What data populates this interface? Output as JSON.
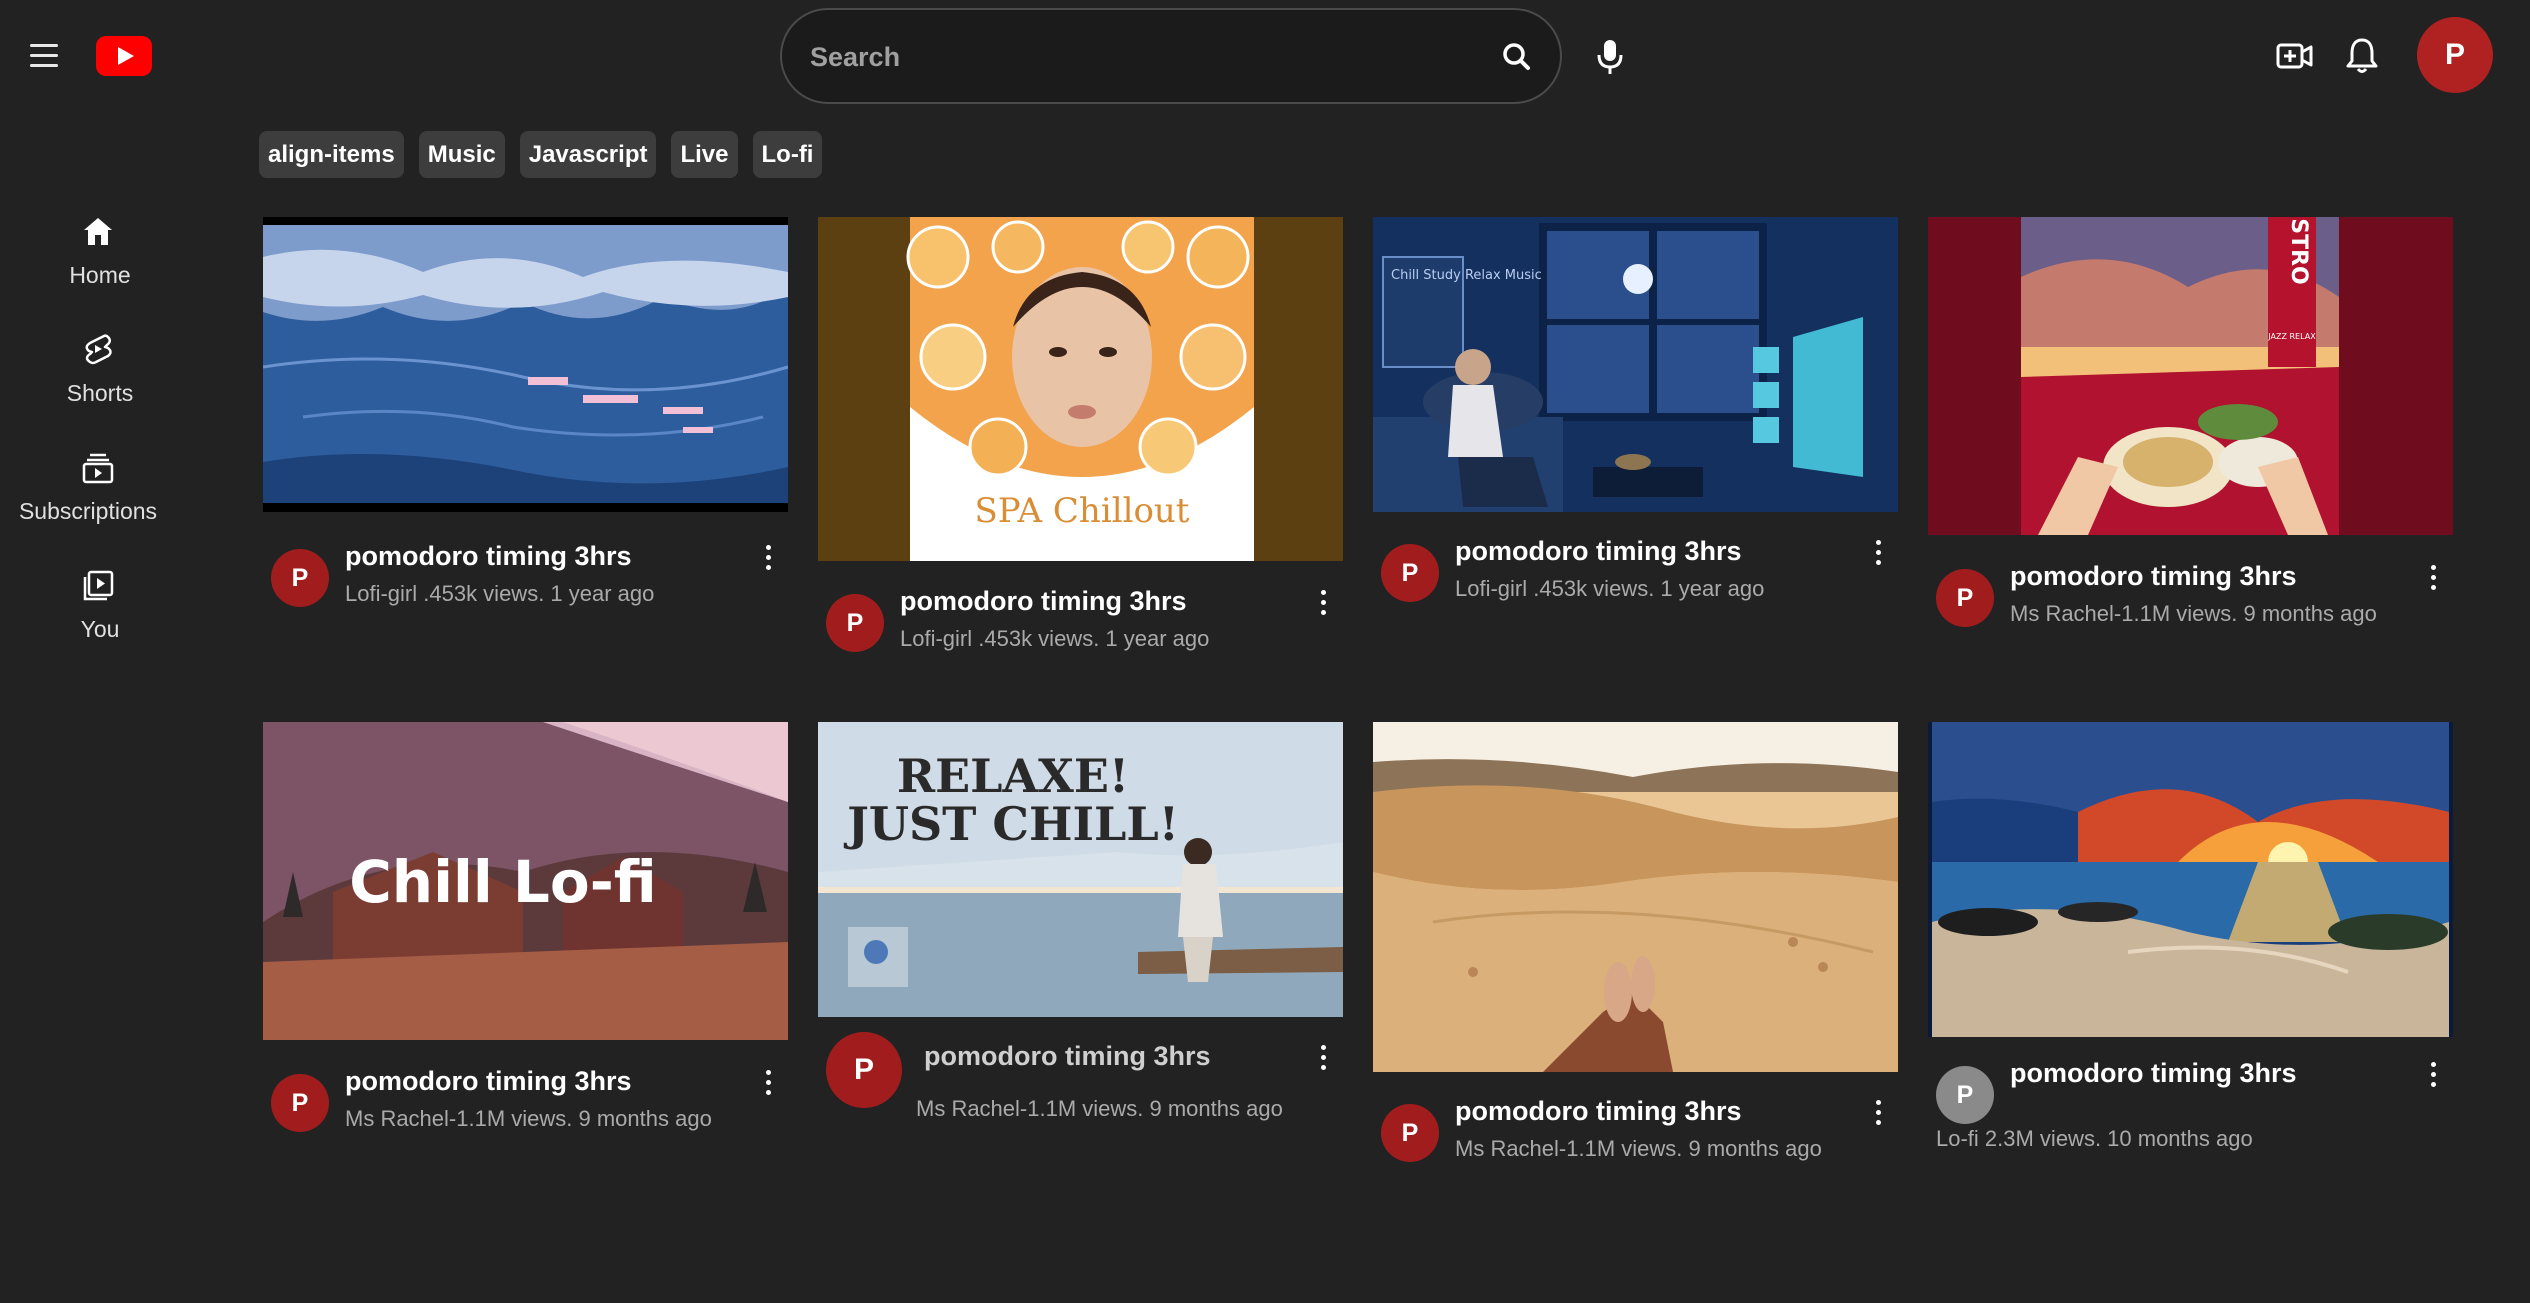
{
  "header": {
    "menu_icon": "hamburger-menu-icon",
    "logo_icon": "youtube-logo-icon",
    "search_placeholder": "Search",
    "search_icon": "search-icon",
    "mic_icon": "microphone-icon",
    "create_icon": "create-video-icon",
    "bell_icon": "notifications-bell-icon",
    "avatar_letter": "P",
    "brand_red": "#ff0000",
    "avatar_color": "#b02121"
  },
  "chips": [
    "align-items",
    "Music",
    "Javascript",
    "Live",
    "Lo-fi"
  ],
  "sidebar": {
    "items": [
      {
        "label": "Home",
        "icon": "home-icon"
      },
      {
        "label": "Shorts",
        "icon": "shorts-icon"
      },
      {
        "label": "Subscriptions",
        "icon": "subscriptions-icon"
      },
      {
        "label": "You",
        "icon": "you-library-icon"
      }
    ]
  },
  "videos": [
    {
      "title": "pomodoro timing 3hrs",
      "meta": "Lofi-girl .453k views. 1 year ago",
      "avatar": "P",
      "thumbnail": "anime-ocean-clouds"
    },
    {
      "title": "pomodoro timing 3hrs",
      "meta": "Lofi-girl .453k views. 1 year ago",
      "avatar": "P",
      "thumbnail": "spa-chillout-oranges",
      "thumb_text": "SPA Chillout"
    },
    {
      "title": "pomodoro timing 3hrs",
      "meta": "Lofi-girl .453k views. 1 year ago",
      "avatar": "P",
      "thumbnail": "rainy-night-room",
      "thumb_text": "Chill Study Relax Music"
    },
    {
      "title": "pomodoro timing 3hrs",
      "meta": "Ms Rachel-1.1M views. 9 months ago",
      "avatar": "P",
      "thumbnail": "bistro-jazz-table",
      "thumb_text": "BISTRO",
      "thumb_text2": "JAZZ RELAX"
    },
    {
      "title": "pomodoro timing 3hrs",
      "meta": "Ms Rachel-1.1M views. 9 months ago",
      "avatar": "P",
      "thumbnail": "chill-lofi-barn",
      "thumb_text": "Chill Lo-fi"
    },
    {
      "title": "pomodoro timing 3hrs",
      "meta": "Ms Rachel-1.1M views. 9 months ago",
      "avatar": "P",
      "thumbnail": "relaxe-just-chill-sea",
      "thumb_text": "RELAXE!",
      "thumb_text2": "JUST CHILL!"
    },
    {
      "title": "pomodoro timing 3hrs",
      "meta": "Ms Rachel-1.1M views. 9 months ago",
      "avatar": "P",
      "thumbnail": "desert-dunes-feet"
    },
    {
      "title": "pomodoro timing 3hrs",
      "meta": "Lo-fi 2.3M views. 10 months ago",
      "avatar": "P",
      "thumbnail": "sunset-beach"
    }
  ]
}
